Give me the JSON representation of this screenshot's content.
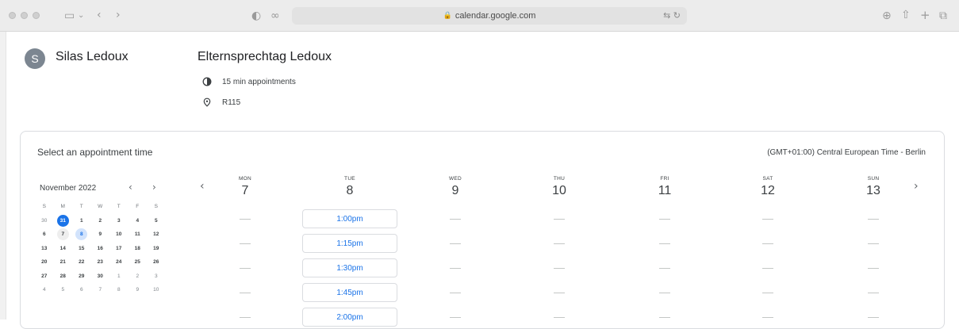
{
  "browser": {
    "url": "calendar.google.com"
  },
  "header": {
    "owner_initial": "S",
    "owner_name": "Silas Ledoux",
    "event_title": "Elternsprechtag Ledoux",
    "duration": "15 min appointments",
    "location": "R115"
  },
  "booking": {
    "title": "Select an appointment time",
    "timezone": "(GMT+01:00) Central European Time - Berlin"
  },
  "mini_calendar": {
    "month_label": "November 2022",
    "weekday_heads": [
      "S",
      "M",
      "T",
      "W",
      "T",
      "F",
      "S"
    ],
    "rows": [
      [
        "30",
        "31",
        "1",
        "2",
        "3",
        "4",
        "5"
      ],
      [
        "6",
        "7",
        "8",
        "9",
        "10",
        "11",
        "12"
      ],
      [
        "13",
        "14",
        "15",
        "16",
        "17",
        "18",
        "19"
      ],
      [
        "20",
        "21",
        "22",
        "23",
        "24",
        "25",
        "26"
      ],
      [
        "27",
        "28",
        "29",
        "30",
        "1",
        "2",
        "3"
      ],
      [
        "4",
        "5",
        "6",
        "7",
        "8",
        "9",
        "10"
      ]
    ]
  },
  "week": {
    "days": [
      {
        "name": "MON",
        "num": "7"
      },
      {
        "name": "TUE",
        "num": "8"
      },
      {
        "name": "WED",
        "num": "9"
      },
      {
        "name": "THU",
        "num": "10"
      },
      {
        "name": "FRI",
        "num": "11"
      },
      {
        "name": "SAT",
        "num": "12"
      },
      {
        "name": "SUN",
        "num": "13"
      }
    ],
    "slots": [
      "1:00pm",
      "1:15pm",
      "1:30pm",
      "1:45pm",
      "2:00pm"
    ]
  }
}
